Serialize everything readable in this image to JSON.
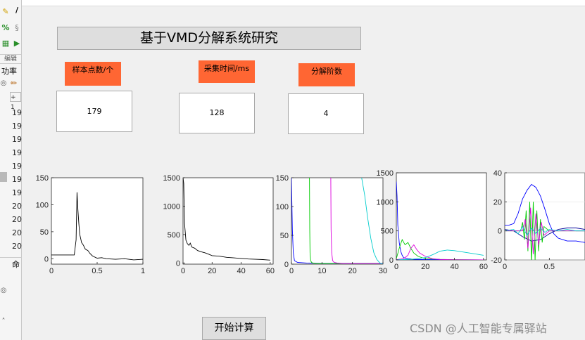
{
  "left_panel": {
    "section_label": "编辑",
    "tab_label": "功率",
    "toolbar_text": "+ 1",
    "rows": [
      "19",
      "19",
      "19",
      "19",
      "19",
      "19",
      "19",
      "20",
      "20",
      "20",
      "20"
    ],
    "command_label": "命"
  },
  "figure": {
    "title": "基于VMD分解系统研究",
    "labels": {
      "sample_points": "样本点数/个",
      "sample_time": "采集时间/ms",
      "decomp_order": "分解阶数"
    },
    "values": {
      "sample_points": "179",
      "sample_time": "128",
      "decomp_order": "4"
    },
    "start_button": "开始计算"
  },
  "watermark": "CSDN @人工智能专属驿站",
  "colors": {
    "label_bg": "#ff6633",
    "axes_bg": "#ffffff",
    "figure_bg": "#f0f0f0"
  },
  "chart_data": [
    {
      "type": "line",
      "x": [
        0,
        0.05,
        0.1,
        0.15,
        0.2,
        0.25,
        0.27,
        0.28,
        0.29,
        0.3,
        0.31,
        0.33,
        0.35,
        0.37,
        0.4,
        0.42,
        0.45,
        0.5,
        0.55,
        0.6,
        0.7,
        0.8,
        0.9,
        1
      ],
      "y": [
        7,
        7,
        7,
        7,
        7,
        7,
        35,
        123,
        90,
        65,
        45,
        30,
        25,
        18,
        15,
        10,
        5,
        1,
        2,
        0,
        -1,
        0,
        -2,
        -1
      ],
      "xlim": [
        0,
        1
      ],
      "ylim": [
        -10,
        150
      ],
      "xticks": [
        "0",
        "0.5",
        "1"
      ],
      "yticks": [
        "0",
        "50",
        "100",
        "150"
      ]
    },
    {
      "type": "line",
      "x": [
        0,
        0.5,
        1,
        2,
        3,
        4,
        5,
        6,
        8,
        10,
        12,
        15,
        18,
        20,
        25,
        30,
        35,
        40,
        45,
        50,
        55,
        60
      ],
      "y": [
        1500,
        1400,
        700,
        400,
        340,
        310,
        350,
        280,
        260,
        220,
        200,
        180,
        150,
        130,
        120,
        100,
        90,
        80,
        70,
        65,
        60,
        50
      ],
      "xlim": [
        0,
        62
      ],
      "ylim": [
        -20,
        1500
      ],
      "xticks": [
        "0",
        "20",
        "40",
        "60"
      ],
      "yticks": [
        "0",
        "500",
        "1000",
        "1500"
      ]
    },
    {
      "type": "line",
      "xlim": [
        0,
        30
      ],
      "ylim": [
        0,
        150
      ],
      "xticks": [
        "0",
        "10",
        "20",
        "30"
      ],
      "yticks": [
        "0",
        "50",
        "100",
        "150"
      ],
      "series": [
        {
          "color": "#0000ff",
          "x": [
            0,
            0.3,
            0.6,
            1,
            2,
            5,
            10,
            20,
            30
          ],
          "y": [
            150,
            60,
            20,
            6,
            3,
            2,
            1,
            1,
            1
          ]
        },
        {
          "color": "#00cc00",
          "x": [
            5.9,
            6,
            6.1,
            6.3,
            6.6,
            7,
            8,
            12,
            30
          ],
          "y": [
            150,
            60,
            20,
            6,
            3,
            2,
            1,
            1,
            1
          ]
        },
        {
          "color": "#dd00dd",
          "x": [
            12.9,
            13,
            13.2,
            13.5,
            14,
            15,
            17,
            20,
            30
          ],
          "y": [
            150,
            60,
            20,
            6,
            3,
            2,
            1,
            1,
            1
          ]
        },
        {
          "color": "#00cccc",
          "x": [
            23,
            24,
            25,
            26,
            27,
            28,
            29,
            30
          ],
          "y": [
            150,
            120,
            80,
            45,
            20,
            8,
            2,
            0
          ]
        }
      ]
    },
    {
      "type": "line",
      "xlim": [
        0,
        62
      ],
      "ylim": [
        0,
        1500
      ],
      "xticks": [
        "0",
        "20",
        "40",
        "60"
      ],
      "yticks": [
        "0",
        "500",
        "1000",
        "1500"
      ],
      "series": [
        {
          "color": "#0000ff",
          "x": [
            0,
            0.5,
            1,
            2,
            3,
            4,
            5,
            8,
            12,
            20,
            30,
            40,
            50,
            60
          ],
          "y": [
            1350,
            1100,
            600,
            300,
            150,
            80,
            40,
            20,
            10,
            5,
            5,
            3,
            2,
            1
          ]
        },
        {
          "color": "#00cc00",
          "x": [
            0,
            2,
            4,
            6,
            8,
            10,
            12,
            15,
            20,
            30,
            40,
            50,
            60
          ],
          "y": [
            20,
            200,
            350,
            260,
            300,
            200,
            120,
            60,
            20,
            10,
            5,
            3,
            1
          ]
        },
        {
          "color": "#dd00dd",
          "x": [
            0,
            5,
            8,
            10,
            12,
            14,
            16,
            20,
            25,
            30,
            40,
            60
          ],
          "y": [
            5,
            20,
            80,
            200,
            260,
            180,
            120,
            60,
            20,
            8,
            3,
            1
          ]
        },
        {
          "color": "#00cccc",
          "x": [
            0,
            10,
            20,
            25,
            30,
            35,
            40,
            45,
            50,
            55,
            60
          ],
          "y": [
            3,
            10,
            40,
            90,
            150,
            170,
            160,
            140,
            120,
            100,
            80
          ]
        }
      ]
    },
    {
      "type": "line",
      "xlim": [
        0,
        0.9
      ],
      "ylim": [
        -20,
        40
      ],
      "xticks": [
        "0",
        "0.5"
      ],
      "yticks": [
        "-20",
        "0",
        "20",
        "40"
      ],
      "series": [
        {
          "color": "#0000ff",
          "x": [
            0,
            0.05,
            0.1,
            0.15,
            0.2,
            0.25,
            0.3,
            0.35,
            0.4,
            0.45,
            0.5,
            0.55,
            0.6,
            0.65,
            0.7,
            0.8,
            0.9
          ],
          "y": [
            4,
            4,
            5,
            12,
            22,
            28,
            32,
            30,
            24,
            15,
            5,
            -2,
            -5,
            -6,
            -7,
            -7,
            -8
          ]
        },
        {
          "color": "#000099",
          "x": [
            0,
            0.1,
            0.2,
            0.3,
            0.4,
            0.5,
            0.6,
            0.7,
            0.8,
            0.9
          ],
          "y": [
            1,
            0,
            -4,
            -7,
            -6,
            -2,
            1,
            2,
            2,
            1
          ]
        },
        {
          "color": "#00cc00",
          "x": [
            0,
            0.18,
            0.2,
            0.22,
            0.24,
            0.26,
            0.28,
            0.3,
            0.32,
            0.34,
            0.36,
            0.38,
            0.4,
            0.42,
            0.44,
            0.5,
            0.9
          ],
          "y": [
            0,
            0,
            6,
            -6,
            14,
            -14,
            20,
            -22,
            20,
            -20,
            14,
            -14,
            8,
            -8,
            3,
            0,
            0
          ]
        },
        {
          "color": "#dd00dd",
          "x": [
            0,
            0.2,
            0.23,
            0.26,
            0.29,
            0.32,
            0.35,
            0.38,
            0.41,
            0.44,
            0.5,
            0.9
          ],
          "y": [
            0,
            0,
            8,
            -12,
            16,
            -16,
            12,
            -10,
            6,
            -3,
            0,
            0
          ]
        },
        {
          "color": "#00cccc",
          "x": [
            0,
            0.1,
            0.15,
            0.2,
            0.25,
            0.3,
            0.35,
            0.4,
            0.45,
            0.5,
            0.6,
            0.7,
            0.8,
            0.9
          ],
          "y": [
            0,
            1,
            -2,
            3,
            -3,
            2,
            -2,
            2,
            -1,
            1,
            0,
            1,
            0,
            0
          ]
        }
      ]
    }
  ]
}
